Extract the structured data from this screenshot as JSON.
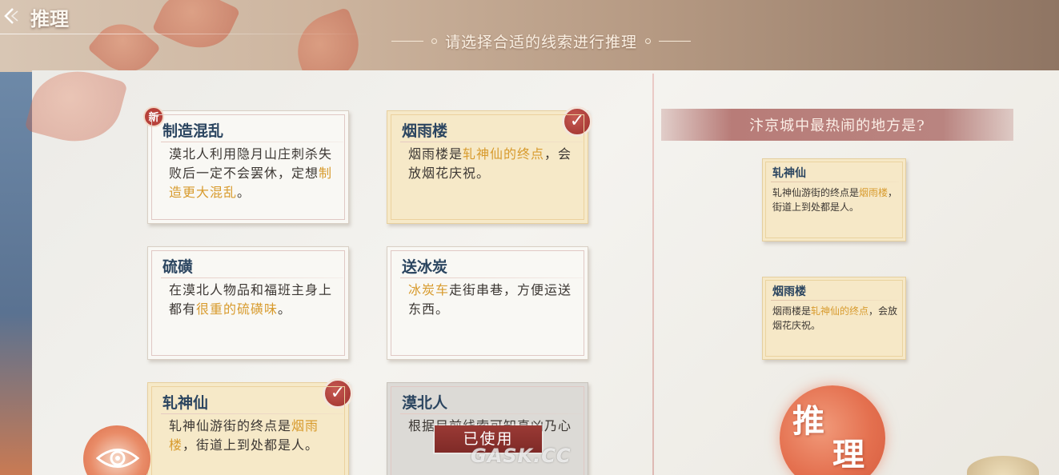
{
  "header": {
    "title": "推理",
    "instruction": "请选择合适的线索进行推理"
  },
  "clues": [
    {
      "title": "制造混乱",
      "is_new": true,
      "new_label": "新",
      "selected": false,
      "used": false,
      "body_parts": [
        "漠北人利用隐月山庄刺杀失败后一定不会罢休，定想",
        "制造更大混乱",
        "。"
      ]
    },
    {
      "title": "烟雨楼",
      "selected": true,
      "used": false,
      "body_parts": [
        "烟雨楼是",
        "轧神仙的终点",
        "，会放烟花庆祝。"
      ]
    },
    {
      "title": "硫磺",
      "selected": false,
      "used": false,
      "body_parts": [
        "在漠北人物品和福班主身上都有",
        "很重的硫磺味",
        "。"
      ]
    },
    {
      "title": "送冰炭",
      "selected": false,
      "used": false,
      "body_parts": [
        "",
        "冰炭车",
        "走街串巷，方便运送东西。"
      ]
    },
    {
      "title": "轧神仙",
      "selected": true,
      "used": false,
      "body_parts": [
        "轧神仙游街的终点是",
        "烟雨楼",
        "，街道上到处都是人。"
      ]
    },
    {
      "title": "漠北人",
      "selected": false,
      "used": true,
      "body_parts": [
        "根据目前线索可知真凶乃心",
        "",
        ""
      ]
    }
  ],
  "used_label": "已使用",
  "question": "汴京城中最热闹的地方是?",
  "answer_slots": [
    {
      "title": "轧神仙",
      "body_parts": [
        "轧神仙游街的终点是",
        "烟雨楼",
        "，街道上到处都是人。"
      ]
    },
    {
      "title": "烟雨楼",
      "body_parts": [
        "烟雨楼是",
        "轧神仙的终点",
        "，会放烟花庆祝。"
      ]
    }
  ],
  "infer_button": {
    "char1": "推",
    "char2": "理"
  },
  "watermark": "GASK.CC",
  "icons": {
    "back": "back-arrow-icon",
    "check": "checkmark-icon",
    "eye": "eye-icon"
  },
  "colors": {
    "highlight": "#d89b2e",
    "title": "#2b4560",
    "badge_red": "#9e2f2c",
    "infer_orange": "#e4704f"
  }
}
